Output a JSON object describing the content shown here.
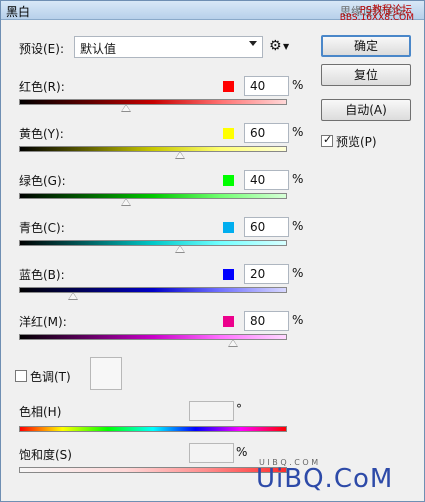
{
  "window": {
    "title": "黑白"
  },
  "watermarks": {
    "top": "思缘设计论坛",
    "ps": "PS教程论坛",
    "url": "BBS.16XX8.COM",
    "bottom": "UiBQ.CoM",
    "bottom_small": "U I B Q . C O M"
  },
  "preset": {
    "label": "预设(E):",
    "value": "默认值"
  },
  "buttons": {
    "ok": "确定",
    "reset": "复位",
    "auto": "自动(A)"
  },
  "preview": {
    "label": "预览(P)",
    "checked": true
  },
  "icons": {
    "options": "gear-icon",
    "caret": "chevron-down-icon"
  },
  "colors": [
    {
      "label": "红色(R):",
      "value": "40",
      "unit": "%",
      "swatch": "#ff0000",
      "gradient": "linear-gradient(90deg,#000 0%,#5b0000 25%,#c60000 50%,#ff6f6f 75%,#ffd8d8 100%)",
      "level": 0.4
    },
    {
      "label": "黄色(Y):",
      "value": "60",
      "unit": "%",
      "swatch": "#ffff00",
      "gradient": "linear-gradient(90deg,#000 0%,#5f5f00 25%,#c8c800 50%,#ffff70 75%,#ffffd8 100%)",
      "level": 0.6
    },
    {
      "label": "绿色(G):",
      "value": "40",
      "unit": "%",
      "swatch": "#00ff00",
      "gradient": "linear-gradient(90deg,#000 0%,#005f00 25%,#00c800 50%,#70ff70 75%,#d8ffd8 100%)",
      "level": 0.4
    },
    {
      "label": "青色(C):",
      "value": "60",
      "unit": "%",
      "swatch": "#00aeef",
      "gradient": "linear-gradient(90deg,#000 0%,#005f5f 25%,#00c8c8 50%,#70ffff 75%,#d8ffff 100%)",
      "level": 0.6
    },
    {
      "label": "蓝色(B):",
      "value": "20",
      "unit": "%",
      "swatch": "#0000ff",
      "gradient": "linear-gradient(90deg,#000 0%,#00005f 25%,#0000c8 50%,#7070ff 75%,#d8d8ff 100%)",
      "level": 0.2
    },
    {
      "label": "洋红(M):",
      "value": "80",
      "unit": "%",
      "swatch": "#ec008c",
      "gradient": "linear-gradient(90deg,#000 0%,#5f005f 25%,#c800c8 50%,#ff70ff 75%,#ffd8ff 100%)",
      "level": 0.8
    }
  ],
  "tint": {
    "label": "色调(T)",
    "checked": false
  },
  "hue": {
    "label": "色相(H)",
    "value": "",
    "unit": "°"
  },
  "saturation": {
    "label": "饱和度(S)",
    "value": "",
    "unit": "%"
  }
}
